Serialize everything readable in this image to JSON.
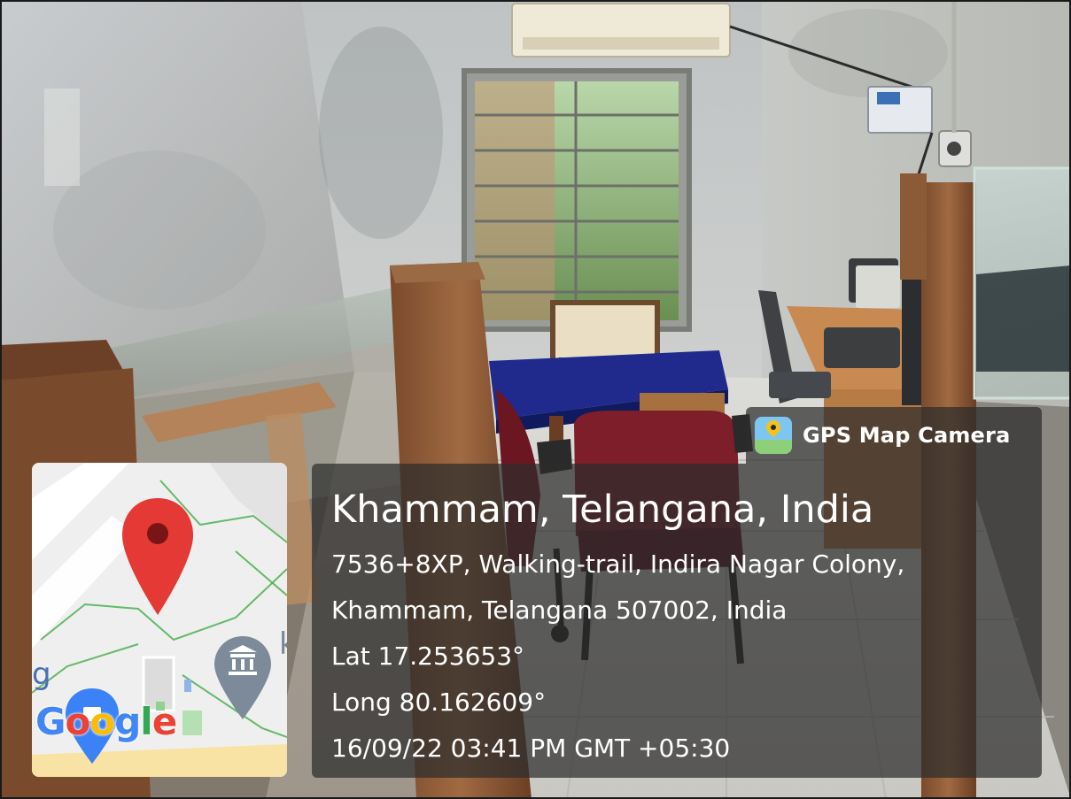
{
  "overlay": {
    "app_name": "GPS Map Camera",
    "place_title": "Khammam, Telangana, India",
    "address_line1": "7536+8XP, Walking-trail, Indira Nagar Colony,",
    "address_line2": "Khammam, Telangana 507002, India",
    "latitude": "Lat 17.253653°",
    "longitude": "Long 80.162609°",
    "timestamp": "16/09/22 03:41 PM GMT +05:30"
  },
  "map": {
    "logo_letters": [
      "G",
      "o",
      "o",
      "g",
      "l",
      "e"
    ],
    "logo_colors": [
      "#4285F4",
      "#EA4335",
      "#FBBC05",
      "#4285F4",
      "#34A853",
      "#EA4335"
    ],
    "partial_labels": [
      "g",
      "k"
    ],
    "pin_color": "#E53935",
    "poi_icon": "bank-icon"
  },
  "colors": {
    "panel_bg": "rgba(45,45,45,0.72)",
    "text": "#ffffff"
  }
}
